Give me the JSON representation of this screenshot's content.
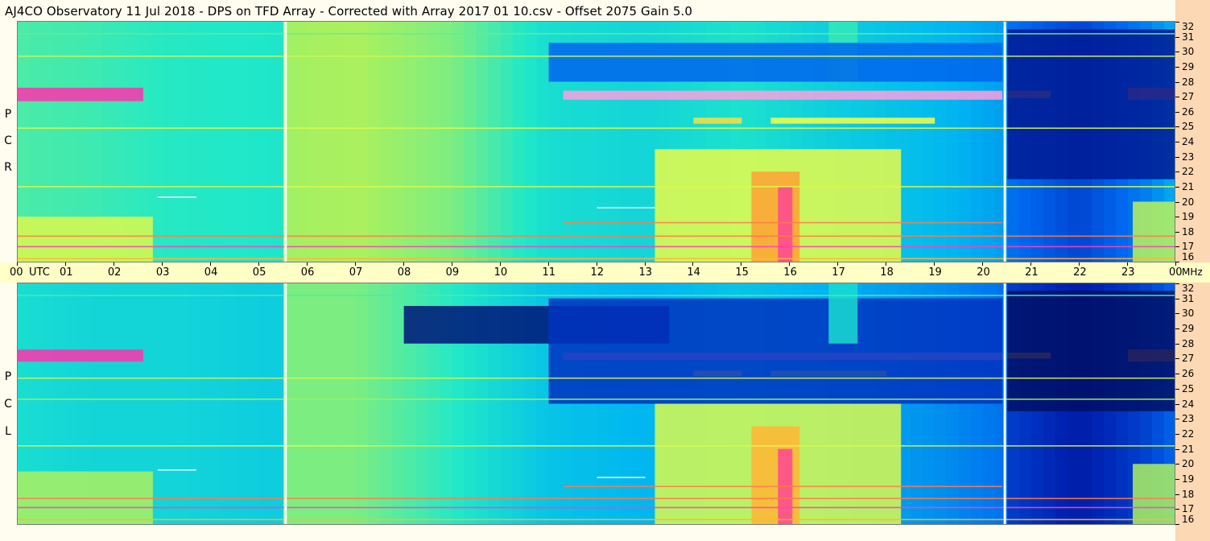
{
  "title": "AJ4CO Observatory  11 Jul 2018  -  DPS on TFD Array  -  Corrected with Array 2017 01 10.csv  -  Offset 2075  Gain 5.0",
  "panels": {
    "top": {
      "polarization_letters": [
        "P",
        "C",
        "R"
      ]
    },
    "bottom": {
      "polarization_letters": [
        "P",
        "C",
        "L"
      ]
    }
  },
  "colors": {
    "background": "#fefdf0",
    "time_axis_band": "#ffffc6",
    "freq_axis_band": "#fcd8b4",
    "colormap": [
      "#000a4a",
      "#0020b0",
      "#0066ee",
      "#00b8f0",
      "#20e8c8",
      "#a8f060",
      "#ffff40",
      "#ff9030",
      "#ff2ab8",
      "#ffffff"
    ]
  },
  "chart_data": {
    "type": "heatmap",
    "title": "AJ4CO Observatory  11 Jul 2018  -  DPS on TFD Array  -  Corrected with Array 2017 01 10.csv  -  Offset 2075  Gain 5.0",
    "x_axis": {
      "unit_label": "UTC",
      "range_hours": [
        0,
        24
      ],
      "ticks": [
        {
          "hour": 0,
          "label": "00"
        },
        {
          "hour": 1,
          "label": "01"
        },
        {
          "hour": 2,
          "label": "02"
        },
        {
          "hour": 3,
          "label": "03"
        },
        {
          "hour": 4,
          "label": "04"
        },
        {
          "hour": 5,
          "label": "05"
        },
        {
          "hour": 6,
          "label": "06"
        },
        {
          "hour": 7,
          "label": "07"
        },
        {
          "hour": 8,
          "label": "08"
        },
        {
          "hour": 9,
          "label": "09"
        },
        {
          "hour": 10,
          "label": "10"
        },
        {
          "hour": 11,
          "label": "11"
        },
        {
          "hour": 12,
          "label": "12"
        },
        {
          "hour": 13,
          "label": "13"
        },
        {
          "hour": 14,
          "label": "14"
        },
        {
          "hour": 15,
          "label": "15"
        },
        {
          "hour": 16,
          "label": "16"
        },
        {
          "hour": 17,
          "label": "17"
        },
        {
          "hour": 18,
          "label": "18"
        },
        {
          "hour": 19,
          "label": "19"
        },
        {
          "hour": 20,
          "label": "20"
        },
        {
          "hour": 21,
          "label": "21"
        },
        {
          "hour": 22,
          "label": "22"
        },
        {
          "hour": 23,
          "label": "23"
        },
        {
          "hour": 24,
          "label": "00"
        }
      ]
    },
    "y_axis": {
      "unit_label": "MHz",
      "range_mhz": [
        16,
        32
      ],
      "ticks": [
        16,
        17,
        18,
        19,
        20,
        21,
        22,
        23,
        24,
        25,
        26,
        27,
        28,
        29,
        30,
        31,
        32
      ]
    },
    "data_gaps_hours": [
      5.55,
      20.45
    ],
    "series": [
      {
        "name": "RCP",
        "background_by_hour": [
          [
            0,
            0.48
          ],
          [
            1.5,
            0.47
          ],
          [
            3,
            0.45
          ],
          [
            5.5,
            0.44
          ],
          [
            5.6,
            0.55
          ],
          [
            7,
            0.56
          ],
          [
            9,
            0.52
          ],
          [
            11,
            0.42
          ],
          [
            13,
            0.4
          ],
          [
            15,
            0.43
          ],
          [
            17,
            0.38
          ],
          [
            19,
            0.34
          ],
          [
            20.4,
            0.3
          ],
          [
            20.5,
            0.24
          ],
          [
            22,
            0.17
          ],
          [
            23.3,
            0.25
          ],
          [
            24,
            0.32
          ]
        ],
        "features": [
          {
            "kind": "band",
            "t0": 0,
            "t1": 2.6,
            "f0": 26.7,
            "f1": 27.6,
            "intensity": 0.88
          },
          {
            "kind": "band",
            "t0": 11.3,
            "t1": 20.4,
            "f0": 26.8,
            "f1": 27.4,
            "intensity": 0.95
          },
          {
            "kind": "band",
            "t0": 20.5,
            "t1": 21.4,
            "f0": 26.9,
            "f1": 27.4,
            "intensity": 0.78
          },
          {
            "kind": "band",
            "t0": 23.0,
            "t1": 24,
            "f0": 26.8,
            "f1": 27.6,
            "intensity": 0.8
          },
          {
            "kind": "band",
            "t0": 14.0,
            "t1": 15.0,
            "f0": 25.2,
            "f1": 25.6,
            "intensity": 0.7
          },
          {
            "kind": "band",
            "t0": 15.6,
            "t1": 19.0,
            "f0": 25.2,
            "f1": 25.6,
            "intensity": 0.66
          },
          {
            "kind": "band",
            "t0": 0,
            "t1": 2.8,
            "f0": 16.0,
            "f1": 19.0,
            "intensity": 0.62
          },
          {
            "kind": "band",
            "t0": 13.2,
            "t1": 18.3,
            "f0": 16.0,
            "f1": 23.5,
            "intensity": 0.64
          },
          {
            "kind": "band",
            "t0": 15.2,
            "t1": 16.2,
            "f0": 16.0,
            "f1": 22.0,
            "intensity": 0.76
          },
          {
            "kind": "band",
            "t0": 15.75,
            "t1": 16.05,
            "f0": 16.0,
            "f1": 21.0,
            "intensity": 0.86
          },
          {
            "kind": "band",
            "t0": 16.8,
            "t1": 17.4,
            "f0": 28.0,
            "f1": 32.0,
            "intensity": 0.46
          },
          {
            "kind": "band",
            "t0": 11.0,
            "t1": 20.4,
            "f0": 28.0,
            "f1": 30.6,
            "intensity": 0.22
          },
          {
            "kind": "band",
            "t0": 20.5,
            "t1": 24,
            "f0": 21.5,
            "f1": 31.5,
            "intensity": 0.08
          },
          {
            "kind": "band",
            "t0": 23.1,
            "t1": 24,
            "f0": 16.0,
            "f1": 20.0,
            "intensity": 0.58
          },
          {
            "kind": "line",
            "t0": 0,
            "t1": 24,
            "f": 17.0,
            "intensity": 0.9
          },
          {
            "kind": "line",
            "t0": 0,
            "t1": 24,
            "f": 17.7,
            "intensity": 0.8
          },
          {
            "kind": "line",
            "t0": 11.3,
            "t1": 20.4,
            "f": 18.6,
            "intensity": 0.8
          },
          {
            "kind": "line",
            "t0": 0,
            "t1": 24,
            "f": 16.2,
            "intensity": 0.74
          },
          {
            "kind": "line",
            "t0": 12.0,
            "t1": 13.2,
            "f": 19.6,
            "intensity": 1.0
          },
          {
            "kind": "line",
            "t0": 2.9,
            "t1": 3.7,
            "f": 20.3,
            "intensity": 1.0
          },
          {
            "kind": "line",
            "t0": 0,
            "t1": 24,
            "f": 21.0,
            "intensity": 0.62
          },
          {
            "kind": "line",
            "t0": 0,
            "t1": 24,
            "f": 29.7,
            "intensity": 0.6
          },
          {
            "kind": "line",
            "t0": 0,
            "t1": 24,
            "f": 24.9,
            "intensity": 0.62
          },
          {
            "kind": "line",
            "t0": 0,
            "t1": 24,
            "f": 31.2,
            "intensity": 0.5
          }
        ]
      },
      {
        "name": "LCP",
        "background_by_hour": [
          [
            0,
            0.42
          ],
          [
            1.5,
            0.4
          ],
          [
            3,
            0.4
          ],
          [
            5.5,
            0.38
          ],
          [
            5.6,
            0.52
          ],
          [
            7,
            0.52
          ],
          [
            9,
            0.45
          ],
          [
            11,
            0.36
          ],
          [
            13,
            0.33
          ],
          [
            15,
            0.36
          ],
          [
            17,
            0.32
          ],
          [
            19,
            0.28
          ],
          [
            20.4,
            0.24
          ],
          [
            20.5,
            0.16
          ],
          [
            22,
            0.1
          ],
          [
            23.3,
            0.16
          ],
          [
            24,
            0.22
          ]
        ],
        "features": [
          {
            "kind": "band",
            "t0": 0,
            "t1": 2.6,
            "f0": 26.8,
            "f1": 27.6,
            "intensity": 0.88
          },
          {
            "kind": "band",
            "t0": 11.3,
            "t1": 20.4,
            "f0": 26.9,
            "f1": 27.4,
            "intensity": 0.95
          },
          {
            "kind": "band",
            "t0": 20.5,
            "t1": 21.4,
            "f0": 27.0,
            "f1": 27.4,
            "intensity": 0.75
          },
          {
            "kind": "band",
            "t0": 23.0,
            "t1": 24,
            "f0": 26.8,
            "f1": 27.6,
            "intensity": 0.78
          },
          {
            "kind": "band",
            "t0": 14.0,
            "t1": 15.0,
            "f0": 25.8,
            "f1": 26.2,
            "intensity": 0.68
          },
          {
            "kind": "band",
            "t0": 15.6,
            "t1": 18.0,
            "f0": 25.8,
            "f1": 26.2,
            "intensity": 0.62
          },
          {
            "kind": "band",
            "t0": 8.0,
            "t1": 13.5,
            "f0": 28.0,
            "f1": 30.5,
            "intensity": 0.05
          },
          {
            "kind": "band",
            "t0": 11.0,
            "t1": 20.4,
            "f0": 24.0,
            "f1": 31.0,
            "intensity": 0.14
          },
          {
            "kind": "band",
            "t0": 20.5,
            "t1": 24,
            "f0": 23.5,
            "f1": 31.5,
            "intensity": 0.03
          },
          {
            "kind": "band",
            "t0": 0,
            "t1": 2.8,
            "f0": 16.0,
            "f1": 19.5,
            "intensity": 0.56
          },
          {
            "kind": "band",
            "t0": 13.2,
            "t1": 18.3,
            "f0": 16.0,
            "f1": 24.0,
            "intensity": 0.62
          },
          {
            "kind": "band",
            "t0": 15.2,
            "t1": 16.2,
            "f0": 16.0,
            "f1": 22.5,
            "intensity": 0.74
          },
          {
            "kind": "band",
            "t0": 15.75,
            "t1": 16.05,
            "f0": 16.0,
            "f1": 21.0,
            "intensity": 0.86
          },
          {
            "kind": "band",
            "t0": 16.8,
            "t1": 17.4,
            "f0": 28.0,
            "f1": 32.0,
            "intensity": 0.42
          },
          {
            "kind": "band",
            "t0": 23.1,
            "t1": 24,
            "f0": 16.0,
            "f1": 20.0,
            "intensity": 0.56
          },
          {
            "kind": "line",
            "t0": 0,
            "t1": 24,
            "f": 17.1,
            "intensity": 0.9
          },
          {
            "kind": "line",
            "t0": 0,
            "t1": 24,
            "f": 17.7,
            "intensity": 0.8
          },
          {
            "kind": "line",
            "t0": 11.3,
            "t1": 20.4,
            "f": 18.5,
            "intensity": 0.8
          },
          {
            "kind": "line",
            "t0": 0,
            "t1": 24,
            "f": 16.3,
            "intensity": 0.74
          },
          {
            "kind": "line",
            "t0": 12.0,
            "t1": 13.0,
            "f": 19.1,
            "intensity": 1.0
          },
          {
            "kind": "line",
            "t0": 2.9,
            "t1": 3.7,
            "f": 19.6,
            "intensity": 1.0
          },
          {
            "kind": "line",
            "t0": 0,
            "t1": 24,
            "f": 21.2,
            "intensity": 0.62
          },
          {
            "kind": "line",
            "t0": 0,
            "t1": 24,
            "f": 25.7,
            "intensity": 0.6
          },
          {
            "kind": "line",
            "t0": 0,
            "t1": 24,
            "f": 24.3,
            "intensity": 0.55
          },
          {
            "kind": "line",
            "t0": 0,
            "t1": 24,
            "f": 31.2,
            "intensity": 0.48
          }
        ]
      }
    ]
  }
}
